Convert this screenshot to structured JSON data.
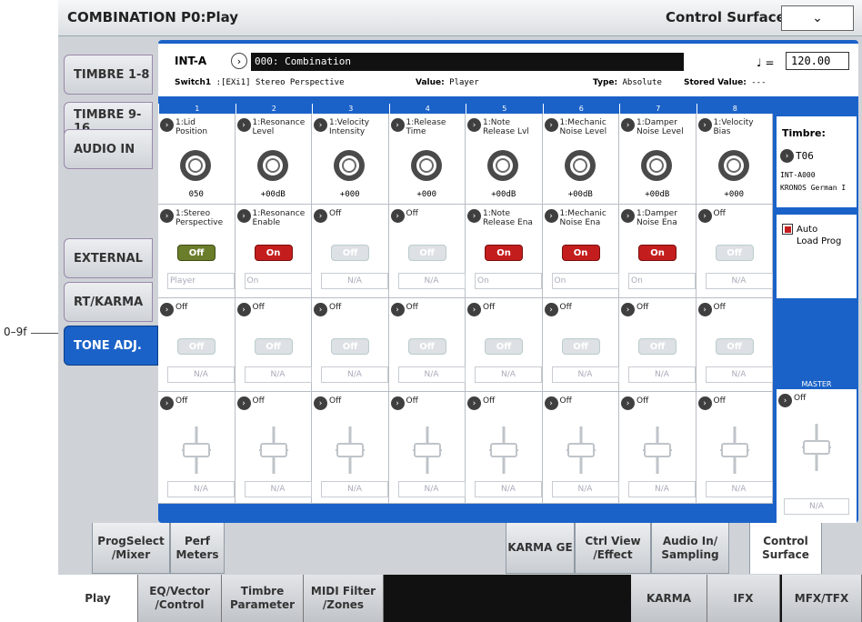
{
  "window": {
    "title": "COMBINATION P0:Play",
    "page_title": "Control Surface",
    "dropdown_glyph": "⌄"
  },
  "callout": "0–9f",
  "side_tabs": [
    {
      "label": "TIMBRE 1-8",
      "active": false
    },
    {
      "label": "TIMBRE 9-16",
      "active": false
    },
    {
      "label": "AUDIO IN",
      "active": false
    },
    {
      "label": "EXTERNAL",
      "active": false
    },
    {
      "label": "RT/KARMA",
      "active": false
    },
    {
      "label": "TONE ADJ.",
      "active": true
    }
  ],
  "header": {
    "bank": "INT-A",
    "combi_name": "000: Combination",
    "note_symbol": "♩ =",
    "tempo": "120.00",
    "switch_label": "Switch1",
    "switch_value": ":[EXi1] Stereo Perspective",
    "value_label": "Value:",
    "value": "Player",
    "type_label": "Type:",
    "type": "Absolute",
    "stored_label": "Stored Value:",
    "stored": "---"
  },
  "columns": [
    "1",
    "2",
    "3",
    "4",
    "5",
    "6",
    "7",
    "8"
  ],
  "knobs": [
    {
      "label": "1:Lid\nPosition",
      "value": "050"
    },
    {
      "label": "1:Resonance\nLevel",
      "value": "+00dB"
    },
    {
      "label": "1:Velocity\nIntensity",
      "value": "+000"
    },
    {
      "label": "1:Release\nTime",
      "value": "+000"
    },
    {
      "label": "1:Note\nRelease Lvl",
      "value": "+00dB"
    },
    {
      "label": "1:Mechanic\nNoise Level",
      "value": "+00dB"
    },
    {
      "label": "1:Damper\nNoise Level",
      "value": "+00dB"
    },
    {
      "label": "1:Velocity\nBias",
      "value": "+000"
    }
  ],
  "switches1": [
    {
      "label": "1:Stereo\nPerspective",
      "btn": "Off",
      "state": "off",
      "value": "Player"
    },
    {
      "label": "1:Resonance\nEnable",
      "btn": "On",
      "state": "on",
      "value": "On"
    },
    {
      "label": "Off",
      "btn": "Off",
      "state": "na",
      "value": "N/A"
    },
    {
      "label": "Off",
      "btn": "Off",
      "state": "na",
      "value": "N/A"
    },
    {
      "label": "1:Note\nRelease Ena",
      "btn": "On",
      "state": "on",
      "value": "On"
    },
    {
      "label": "1:Mechanic\nNoise Ena",
      "btn": "On",
      "state": "on",
      "value": "On"
    },
    {
      "label": "1:Damper\nNoise Ena",
      "btn": "On",
      "state": "on",
      "value": "On"
    },
    {
      "label": "Off",
      "btn": "Off",
      "state": "na",
      "value": "N/A"
    }
  ],
  "switches2": [
    {
      "label": "Off",
      "btn": "Off",
      "value": "N/A"
    },
    {
      "label": "Off",
      "btn": "Off",
      "value": "N/A"
    },
    {
      "label": "Off",
      "btn": "Off",
      "value": "N/A"
    },
    {
      "label": "Off",
      "btn": "Off",
      "value": "N/A"
    },
    {
      "label": "Off",
      "btn": "Off",
      "value": "N/A"
    },
    {
      "label": "Off",
      "btn": "Off",
      "value": "N/A"
    },
    {
      "label": "Off",
      "btn": "Off",
      "value": "N/A"
    },
    {
      "label": "Off",
      "btn": "Off",
      "value": "N/A"
    }
  ],
  "sliders": [
    {
      "label": "Off",
      "value": "N/A"
    },
    {
      "label": "Off",
      "value": "N/A"
    },
    {
      "label": "Off",
      "value": "N/A"
    },
    {
      "label": "Off",
      "value": "N/A"
    },
    {
      "label": "Off",
      "value": "N/A"
    },
    {
      "label": "Off",
      "value": "N/A"
    },
    {
      "label": "Off",
      "value": "N/A"
    },
    {
      "label": "Off",
      "value": "N/A"
    }
  ],
  "timbre": {
    "title": "Timbre:",
    "id": "T06",
    "bank": "INT-A000",
    "name": "KRONOS German I"
  },
  "auto_load": {
    "label": "Auto\nLoad Prog"
  },
  "master": {
    "header": "MASTER",
    "label": "Off",
    "value": "N/A"
  },
  "page_tabs": [
    {
      "label": "ProgSelect\n/Mixer",
      "active": false
    },
    {
      "label": "Perf\nMeters",
      "active": false
    },
    {
      "label": "KARMA GE",
      "active": false
    },
    {
      "label": "Ctrl View\n/Effect",
      "active": false
    },
    {
      "label": "Audio In/\nSampling",
      "active": false
    },
    {
      "label": "Control\nSurface",
      "active": true
    }
  ],
  "mode_tabs": [
    {
      "label": "Play",
      "active": true
    },
    {
      "label": "EQ/Vector\n/Control",
      "active": false
    },
    {
      "label": "Timbre\nParameter",
      "active": false
    },
    {
      "label": "MIDI Filter\n/Zones",
      "active": false
    },
    {
      "label": "KARMA",
      "active": false
    },
    {
      "label": "IFX",
      "active": false
    },
    {
      "label": "MFX/TFX",
      "active": false
    }
  ]
}
